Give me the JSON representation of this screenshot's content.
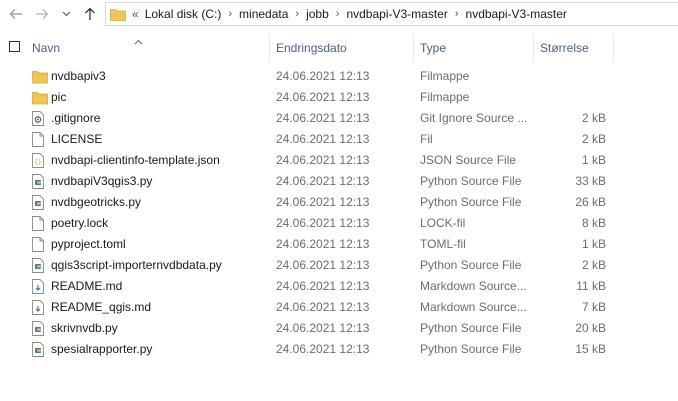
{
  "nav": {
    "back_icon": "arrow-left-icon",
    "forward_icon": "arrow-right-icon",
    "recent_icon": "chevron-down-icon",
    "up_icon": "arrow-up-icon"
  },
  "address": {
    "overflow": "«",
    "crumbs": [
      "Lokal disk (C:)",
      "minedata",
      "jobb",
      "nvdbapi-V3-master",
      "nvdbapi-V3-master"
    ]
  },
  "columns": {
    "name": "Navn",
    "date": "Endringsdato",
    "type": "Type",
    "size": "Størrelse"
  },
  "files": [
    {
      "name": "nvdbapiv3",
      "date": "24.06.2021 12:13",
      "type": "Filmappe",
      "size": "",
      "icon": "folder-icon"
    },
    {
      "name": "pic",
      "date": "24.06.2021 12:13",
      "type": "Filmappe",
      "size": "",
      "icon": "folder-icon"
    },
    {
      "name": ".gitignore",
      "date": "24.06.2021 12:13",
      "type": "Git Ignore Source ...",
      "size": "2 kB",
      "icon": "gitignore-file-icon"
    },
    {
      "name": "LICENSE",
      "date": "24.06.2021 12:13",
      "type": "Fil",
      "size": "2 kB",
      "icon": "blank-file-icon"
    },
    {
      "name": "nvdbapi-clientinfo-template.json",
      "date": "24.06.2021 12:13",
      "type": "JSON Source File",
      "size": "1 kB",
      "icon": "json-file-icon"
    },
    {
      "name": "nvdbapiV3qgis3.py",
      "date": "24.06.2021 12:13",
      "type": "Python Source File",
      "size": "33 kB",
      "icon": "python-file-icon"
    },
    {
      "name": "nvdbgeotricks.py",
      "date": "24.06.2021 12:13",
      "type": "Python Source File",
      "size": "26 kB",
      "icon": "python-file-icon"
    },
    {
      "name": "poetry.lock",
      "date": "24.06.2021 12:13",
      "type": "LOCK-fil",
      "size": "8 kB",
      "icon": "blank-file-icon"
    },
    {
      "name": "pyproject.toml",
      "date": "24.06.2021 12:13",
      "type": "TOML-fil",
      "size": "1 kB",
      "icon": "blank-file-icon"
    },
    {
      "name": "qgis3script-importernvdbdata.py",
      "date": "24.06.2021 12:13",
      "type": "Python Source File",
      "size": "2 kB",
      "icon": "python-file-icon"
    },
    {
      "name": "README.md",
      "date": "24.06.2021 12:13",
      "type": "Markdown Source...",
      "size": "11 kB",
      "icon": "markdown-file-icon"
    },
    {
      "name": "README_qgis.md",
      "date": "24.06.2021 12:13",
      "type": "Markdown Source...",
      "size": "7 kB",
      "icon": "markdown-file-icon"
    },
    {
      "name": "skrivnvdb.py",
      "date": "24.06.2021 12:13",
      "type": "Python Source File",
      "size": "20 kB",
      "icon": "python-file-icon"
    },
    {
      "name": "spesialrapporter.py",
      "date": "24.06.2021 12:13",
      "type": "Python Source File",
      "size": "15 kB",
      "icon": "python-file-icon"
    }
  ],
  "colors": {
    "folder": "#f0c65a",
    "header_text": "#4d6082",
    "python_blue": "#3d7ab8",
    "secondary_text": "#6d6d6d"
  }
}
